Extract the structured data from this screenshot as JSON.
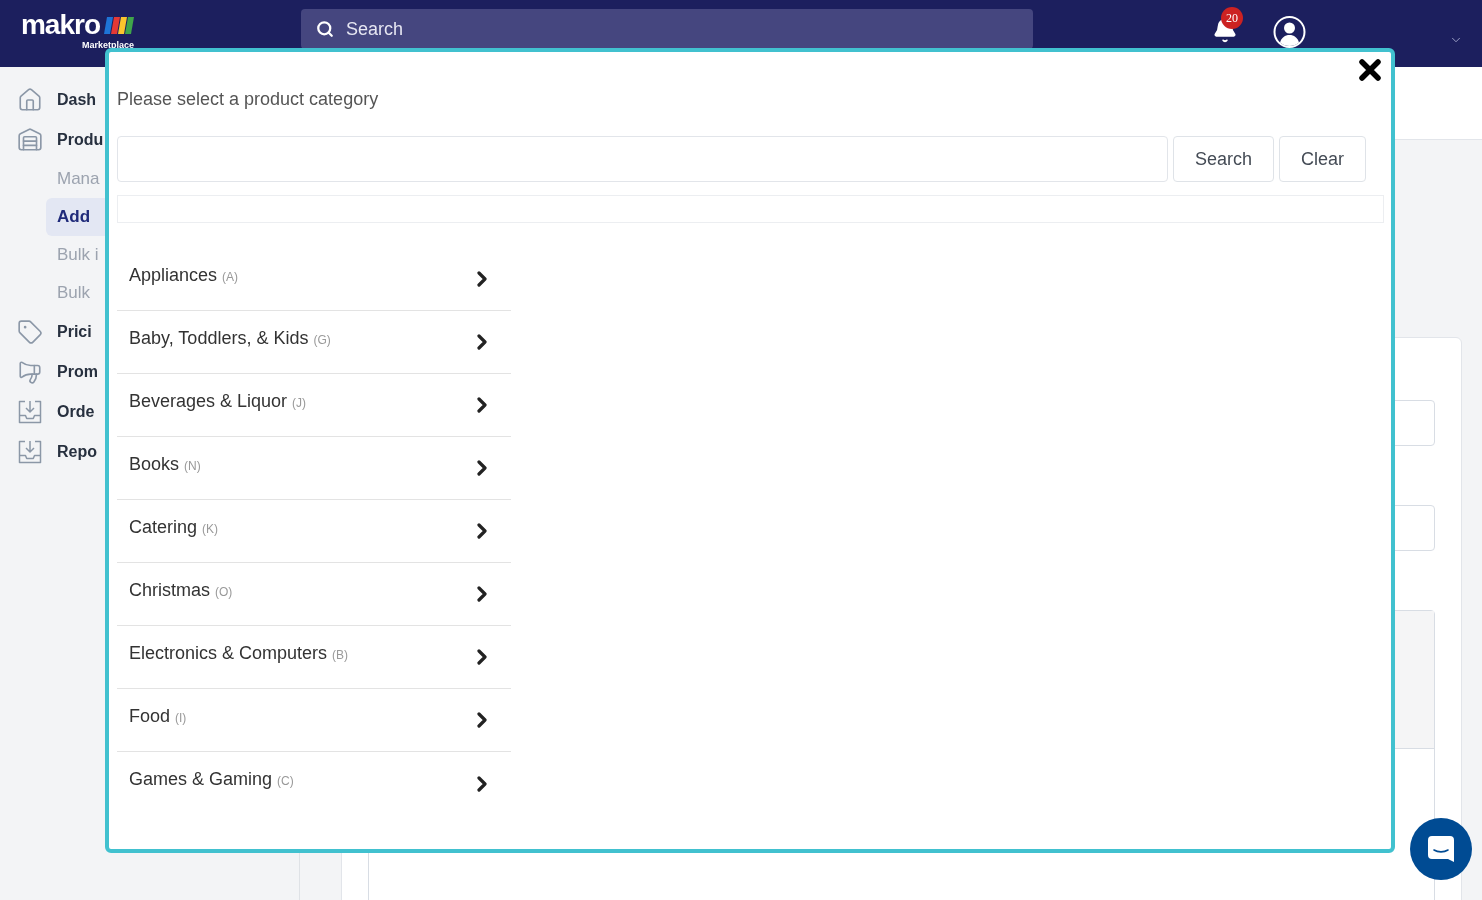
{
  "header": {
    "logo": {
      "wordmark": "makro",
      "tagline": "Marketplace"
    },
    "search": {
      "placeholder": "Search"
    },
    "notifications": {
      "count": "20"
    }
  },
  "sidebar": {
    "items": [
      {
        "label": "Dash",
        "selected": false
      },
      {
        "label": "Produ",
        "selected": false,
        "children": [
          {
            "label": "Mana",
            "selected": false
          },
          {
            "label": "Add",
            "selected": true
          },
          {
            "label": "Bulk i",
            "selected": false
          },
          {
            "label": "Bulk",
            "selected": false
          }
        ]
      },
      {
        "label": "Prici",
        "selected": false
      },
      {
        "label": "Prom",
        "selected": false
      },
      {
        "label": "Orde",
        "selected": false
      },
      {
        "label": "Repo",
        "selected": false
      }
    ]
  },
  "dialog": {
    "title": "Please select a product category",
    "buttons": [
      {
        "label": "Search"
      },
      {
        "label": "Clear"
      }
    ],
    "categories": [
      {
        "name": "Appliances",
        "code": "(A)"
      },
      {
        "name": "Baby, Toddlers, & Kids",
        "code": "(G)"
      },
      {
        "name": "Beverages & Liquor",
        "code": "(J)"
      },
      {
        "name": "Books",
        "code": "(N)"
      },
      {
        "name": "Catering",
        "code": "(K)"
      },
      {
        "name": "Christmas",
        "code": "(O)"
      },
      {
        "name": "Electronics & Computers",
        "code": "(B)"
      },
      {
        "name": "Food",
        "code": "(I)"
      },
      {
        "name": "Games & Gaming",
        "code": "(C)"
      }
    ]
  }
}
